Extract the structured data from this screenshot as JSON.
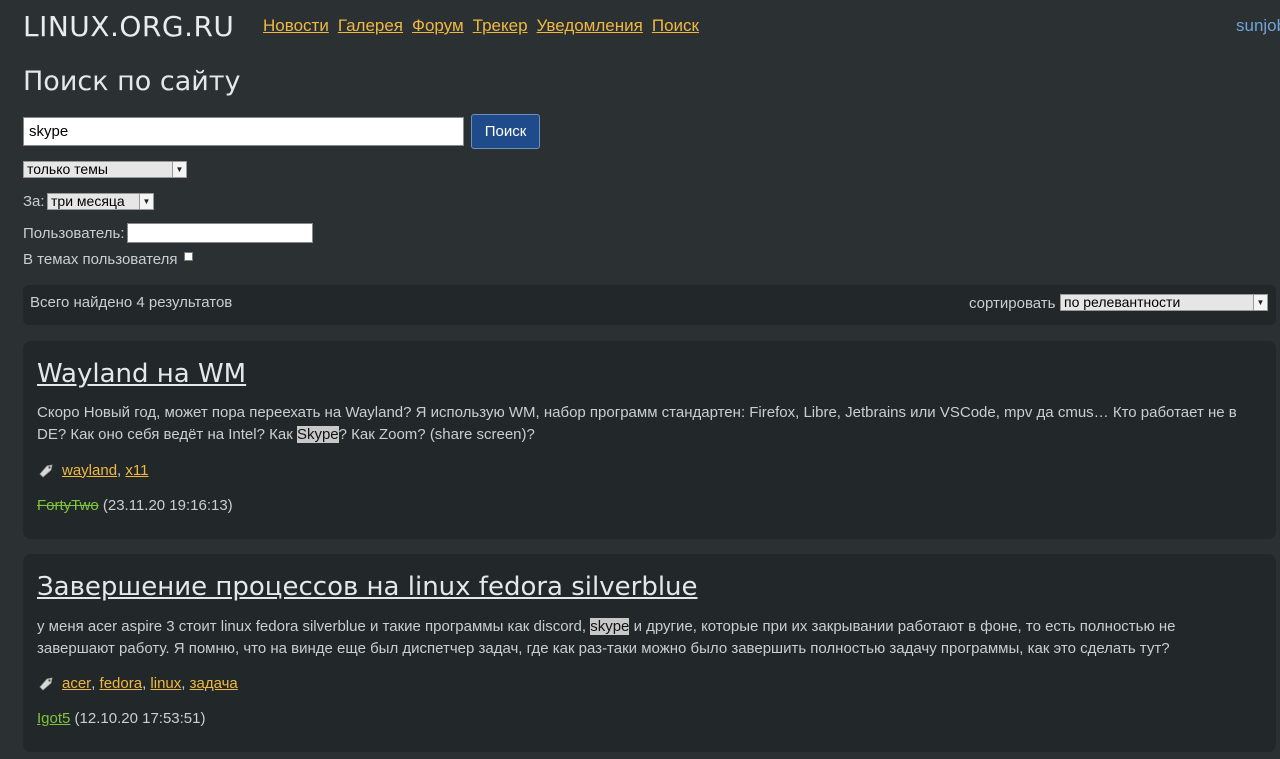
{
  "site": {
    "logo": "LINUX.ORG.RU",
    "nav": [
      "Новости",
      "Галерея",
      "Форум",
      "Трекер",
      "Уведомления",
      "Поиск"
    ],
    "user": "sunjob"
  },
  "search": {
    "title": "Поиск по сайту",
    "query": "skype",
    "button": "Поиск",
    "scope_selected": "только темы",
    "period_label": "За:",
    "period_selected": "три месяца",
    "user_label": "Пользователь:",
    "user_value": "",
    "in_user_topics_label": "В темах пользователя",
    "in_user_topics_checked": false
  },
  "results": {
    "count_text": "Всего найдено 4 результатов",
    "sort_label": "сортировать",
    "sort_selected": "по релевантности",
    "items": [
      {
        "title": "Wayland на WM",
        "text_before": "Скоро Новый год, может пора переехать на Wayland? Я использую WM, набор программ стандартен: Firefox, Libre, Jetbrains или VSCode, mpv да cmus… Кто работает не в DE? Как оно себя ведёт на Intel? Как ",
        "highlight": "Skype",
        "text_after": "? Как Zoom? (share screen)?",
        "tags": [
          "wayland",
          "x11"
        ],
        "author": "FortyTwo",
        "author_deleted": true,
        "date": "(23.11.20 19:16:13)"
      },
      {
        "title": "Завершение процессов на linux fedora silverblue",
        "text_before": "у меня acer aspire 3 стоит linux fedora silverblue и такие программы как discord, ",
        "highlight": "skype",
        "text_after": " и другие, которые при их закрывании работают в фоне, то есть полностью не завершают работу. Я помню, что на винде еще был диспетчер задач, где как раз-таки можно было завершить полностью задачу программы, как это сделать тут?",
        "tags": [
          "acer",
          "fedora",
          "linux",
          "задача"
        ],
        "author": "Igot5",
        "author_deleted": false,
        "date": "(12.10.20 17:53:51)"
      }
    ]
  },
  "colors": {
    "background": "#2b3033",
    "card": "#222729",
    "link": "#f0b840",
    "author": "#7fc43a",
    "user": "#6fa3d6",
    "button": "#1f4b8a"
  }
}
